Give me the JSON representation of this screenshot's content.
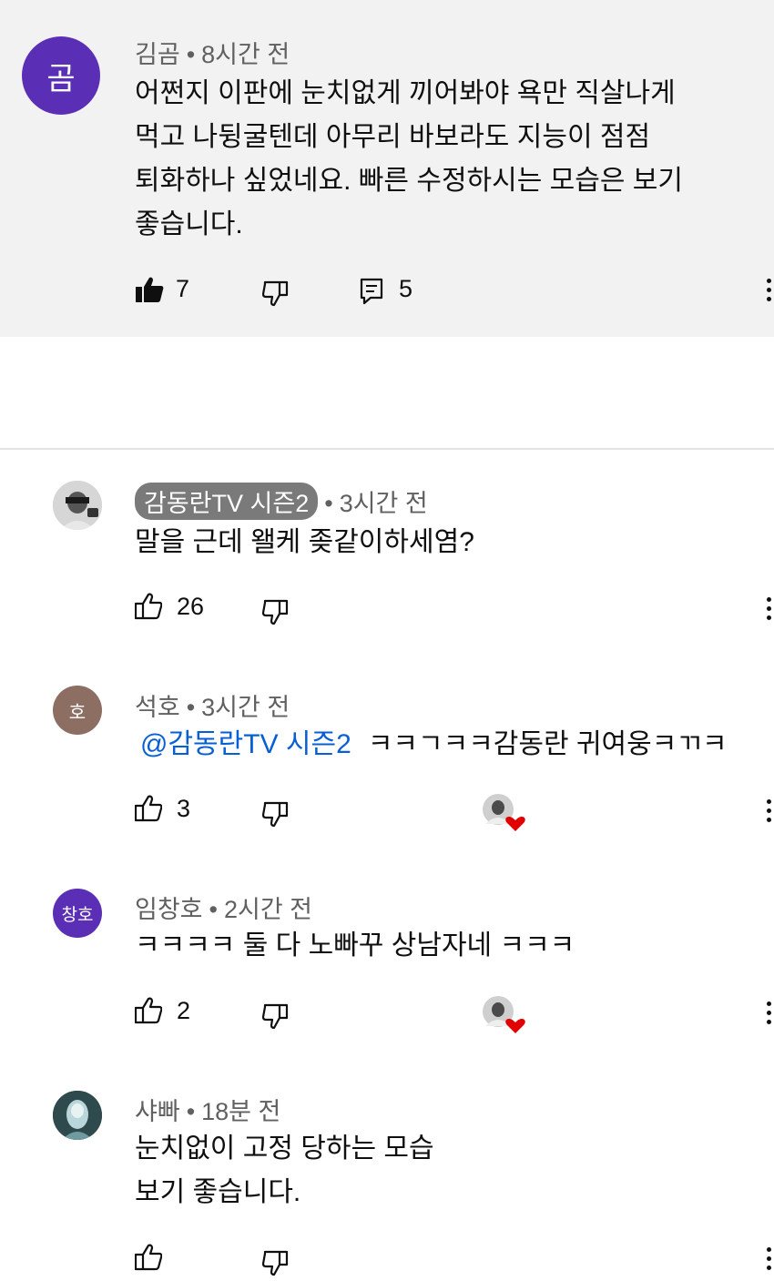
{
  "pinned": {
    "avatar_letter": "곰",
    "author": "김곰",
    "time": "8시간 전",
    "lines": [
      "어쩐지 이판에 눈치없게 끼어봐야 욕만 직살나게",
      "먹고 나뒹굴텐데 아무리 바보라도 지능이 점점",
      "퇴화하나 싶었네요. 빠른 수정하시는 모습은 보기",
      "좋습니다."
    ],
    "likes": "7",
    "replies": "5"
  },
  "separator": "•",
  "replies": [
    {
      "author": "감동란TV 시즌2",
      "time": "3시간 전",
      "text": "말을 근데 왤케 좆같이하세염?",
      "likes": "26"
    },
    {
      "avatar_letter": "호",
      "author": "석호",
      "time": "3시간 전",
      "mention": "@감동란TV 시즌2",
      "text": "ㅋㅋㄱㅋㅋ감동란 귀여웅ㅋㄲㅋ",
      "likes": "3"
    },
    {
      "avatar_letter": "창호",
      "author": "임창호",
      "time": "2시간 전",
      "text": "ㅋㅋㅋㅋ 둘 다 노빠꾸 상남자네 ㅋㅋㅋ",
      "likes": "2"
    },
    {
      "author": "샤빠",
      "time": "18분 전",
      "lines": [
        "눈치없이 고정 당하는 모습",
        "보기 좋습니다."
      ]
    }
  ],
  "colors": {
    "avatar_purple": "#5b2fb5",
    "avatar_brown": "#8d6e63",
    "heart": "#e00000",
    "mention": "#065fd4"
  }
}
